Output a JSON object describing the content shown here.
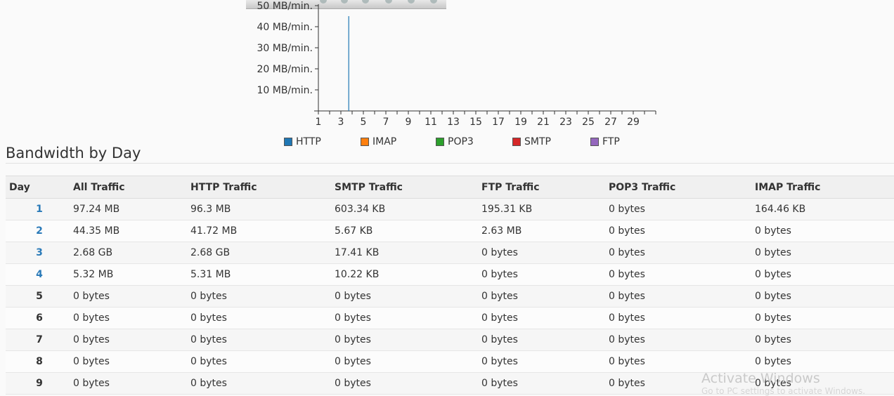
{
  "chart_data": {
    "type": "bar",
    "yticks": [
      "10 MB/min.",
      "20 MB/min.",
      "30 MB/min.",
      "40 MB/min.",
      "50 MB/min."
    ],
    "ylim": [
      0,
      50
    ],
    "x_tick_labels": [
      "1",
      "3",
      "5",
      "7",
      "9",
      "11",
      "13",
      "15",
      "17",
      "19",
      "21",
      "23",
      "25",
      "27",
      "29"
    ],
    "xlim": [
      1,
      31
    ],
    "series": [
      {
        "name": "HTTP",
        "color": "#1f77b4",
        "points": [
          {
            "x": 3.7,
            "y": 45
          }
        ]
      },
      {
        "name": "IMAP",
        "color": "#ff7f0e",
        "points": []
      },
      {
        "name": "POP3",
        "color": "#2ca02c",
        "points": []
      },
      {
        "name": "SMTP",
        "color": "#d62728",
        "points": []
      },
      {
        "name": "FTP",
        "color": "#9467bd",
        "points": []
      }
    ]
  },
  "legend": [
    {
      "label": "HTTP",
      "color": "#1f77b4"
    },
    {
      "label": "IMAP",
      "color": "#ff7f0e"
    },
    {
      "label": "POP3",
      "color": "#2ca02c"
    },
    {
      "label": "SMTP",
      "color": "#d62728"
    },
    {
      "label": "FTP",
      "color": "#9467bd"
    }
  ],
  "section": {
    "title": "Bandwidth by Day"
  },
  "table": {
    "headers": [
      "Day",
      "All Traffic",
      "HTTP Traffic",
      "SMTP Traffic",
      "FTP Traffic",
      "POP3 Traffic",
      "IMAP Traffic"
    ],
    "rows": [
      {
        "day": "1",
        "link": true,
        "all": "97.24 MB",
        "http": "96.3 MB",
        "smtp": "603.34 KB",
        "ftp": "195.31 KB",
        "pop3": "0 bytes",
        "imap": "164.46 KB"
      },
      {
        "day": "2",
        "link": true,
        "all": "44.35 MB",
        "http": "41.72 MB",
        "smtp": "5.67 KB",
        "ftp": "2.63 MB",
        "pop3": "0 bytes",
        "imap": "0 bytes"
      },
      {
        "day": "3",
        "link": true,
        "all": "2.68 GB",
        "http": "2.68 GB",
        "smtp": "17.41 KB",
        "ftp": "0 bytes",
        "pop3": "0 bytes",
        "imap": "0 bytes"
      },
      {
        "day": "4",
        "link": true,
        "all": "5.32 MB",
        "http": "5.31 MB",
        "smtp": "10.22 KB",
        "ftp": "0 bytes",
        "pop3": "0 bytes",
        "imap": "0 bytes"
      },
      {
        "day": "5",
        "link": false,
        "all": "0 bytes",
        "http": "0 bytes",
        "smtp": "0 bytes",
        "ftp": "0 bytes",
        "pop3": "0 bytes",
        "imap": "0 bytes"
      },
      {
        "day": "6",
        "link": false,
        "all": "0 bytes",
        "http": "0 bytes",
        "smtp": "0 bytes",
        "ftp": "0 bytes",
        "pop3": "0 bytes",
        "imap": "0 bytes"
      },
      {
        "day": "7",
        "link": false,
        "all": "0 bytes",
        "http": "0 bytes",
        "smtp": "0 bytes",
        "ftp": "0 bytes",
        "pop3": "0 bytes",
        "imap": "0 bytes"
      },
      {
        "day": "8",
        "link": false,
        "all": "0 bytes",
        "http": "0 bytes",
        "smtp": "0 bytes",
        "ftp": "0 bytes",
        "pop3": "0 bytes",
        "imap": "0 bytes"
      },
      {
        "day": "9",
        "link": false,
        "all": "0 bytes",
        "http": "0 bytes",
        "smtp": "0 bytes",
        "ftp": "0 bytes",
        "pop3": "0 bytes",
        "imap": "0 bytes"
      }
    ]
  },
  "watermark": {
    "title": "Activate Windows",
    "subtitle": "Go to PC settings to activate Windows."
  }
}
